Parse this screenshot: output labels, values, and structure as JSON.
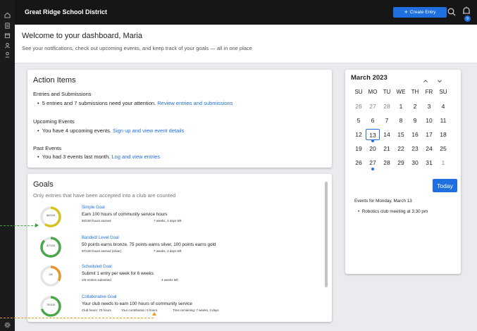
{
  "header": {
    "brand": "Great Ridge School District",
    "create_label": "Create Entry",
    "notification_count": "9"
  },
  "welcome": {
    "title": "Welcome to your dashboard, Maria",
    "subtitle": "See your notifications, check out upcoming events, and keep track of your goals — all in one place"
  },
  "action_items": {
    "title": "Action Items",
    "sections": [
      {
        "title": "Entries and Submissions",
        "text": "5 entries and 7 submissions need your attention.",
        "link": "Review entries and submissions"
      },
      {
        "title": "Upcoming Events",
        "text": "You have 4 upcoming events.",
        "link": "Sign up and view event details"
      },
      {
        "title": "Past Events",
        "text": "You had 3 events last month.",
        "link": "Log and view entries"
      }
    ]
  },
  "goals": {
    "title": "Goals",
    "subtitle": "Only entries that have been accepted into a club are counted",
    "items": [
      {
        "ring_label": "60/100",
        "progress": 0.6,
        "color": "#d9c21e",
        "name": "Simple Goal",
        "desc": "Earn 100 hours of community service hours",
        "meta1": "60/100 hours earned",
        "meta2": "7 weeks, 3 days left"
      },
      {
        "ring_label": "87/100",
        "progress": 0.87,
        "color": "#4aa84a",
        "name": "Banded/ Level Goal",
        "desc": "50 points earns bronze, 75 points earns silver, 100 points earns gold",
        "meta1": "87/100 hours earned (silver)",
        "meta2": "7 weeks, 3 days left"
      },
      {
        "ring_label": "2/6",
        "progress": 0.33,
        "color": "#e8962c",
        "name": "Scheduled Goal",
        "desc": "Submit 1 entry per week for 6 weeks",
        "meta1": "2/6 entries submitted",
        "meta2": "4 weeks left"
      },
      {
        "ring_label": "70/100",
        "progress": 0.7,
        "color": "#4aa84a",
        "name": "Collaborative Goal",
        "desc": "Your club needs to earn 100 hours of community service",
        "meta1": "Club hours: 70 hours",
        "meta2": "Your contribution: 5 hours",
        "meta3": "Time remaining: 7 weeks, 3 days"
      }
    ]
  },
  "calendar": {
    "month": "March 2023",
    "dow": [
      "SU",
      "MO",
      "TU",
      "WE",
      "TH",
      "FR",
      "SU"
    ],
    "weeks": [
      [
        "26",
        "27",
        "28",
        "1",
        "2",
        "3",
        "4"
      ],
      [
        "5",
        "6",
        "7",
        "8",
        "9",
        "10",
        "11"
      ],
      [
        "12",
        "13",
        "14",
        "15",
        "16",
        "17",
        "18"
      ],
      [
        "19",
        "20",
        "21",
        "22",
        "23",
        "24",
        "25"
      ],
      [
        "26",
        "27",
        "28",
        "29",
        "30",
        "31",
        "1"
      ]
    ],
    "today_label": "Today",
    "events_title": "Events for Monday, March 13",
    "event": "Robotics club meeting at 3:30 pm"
  },
  "colors": {
    "accent": "#1f6fe0",
    "topbar": "#161616",
    "rail": "#1b1b1b"
  }
}
